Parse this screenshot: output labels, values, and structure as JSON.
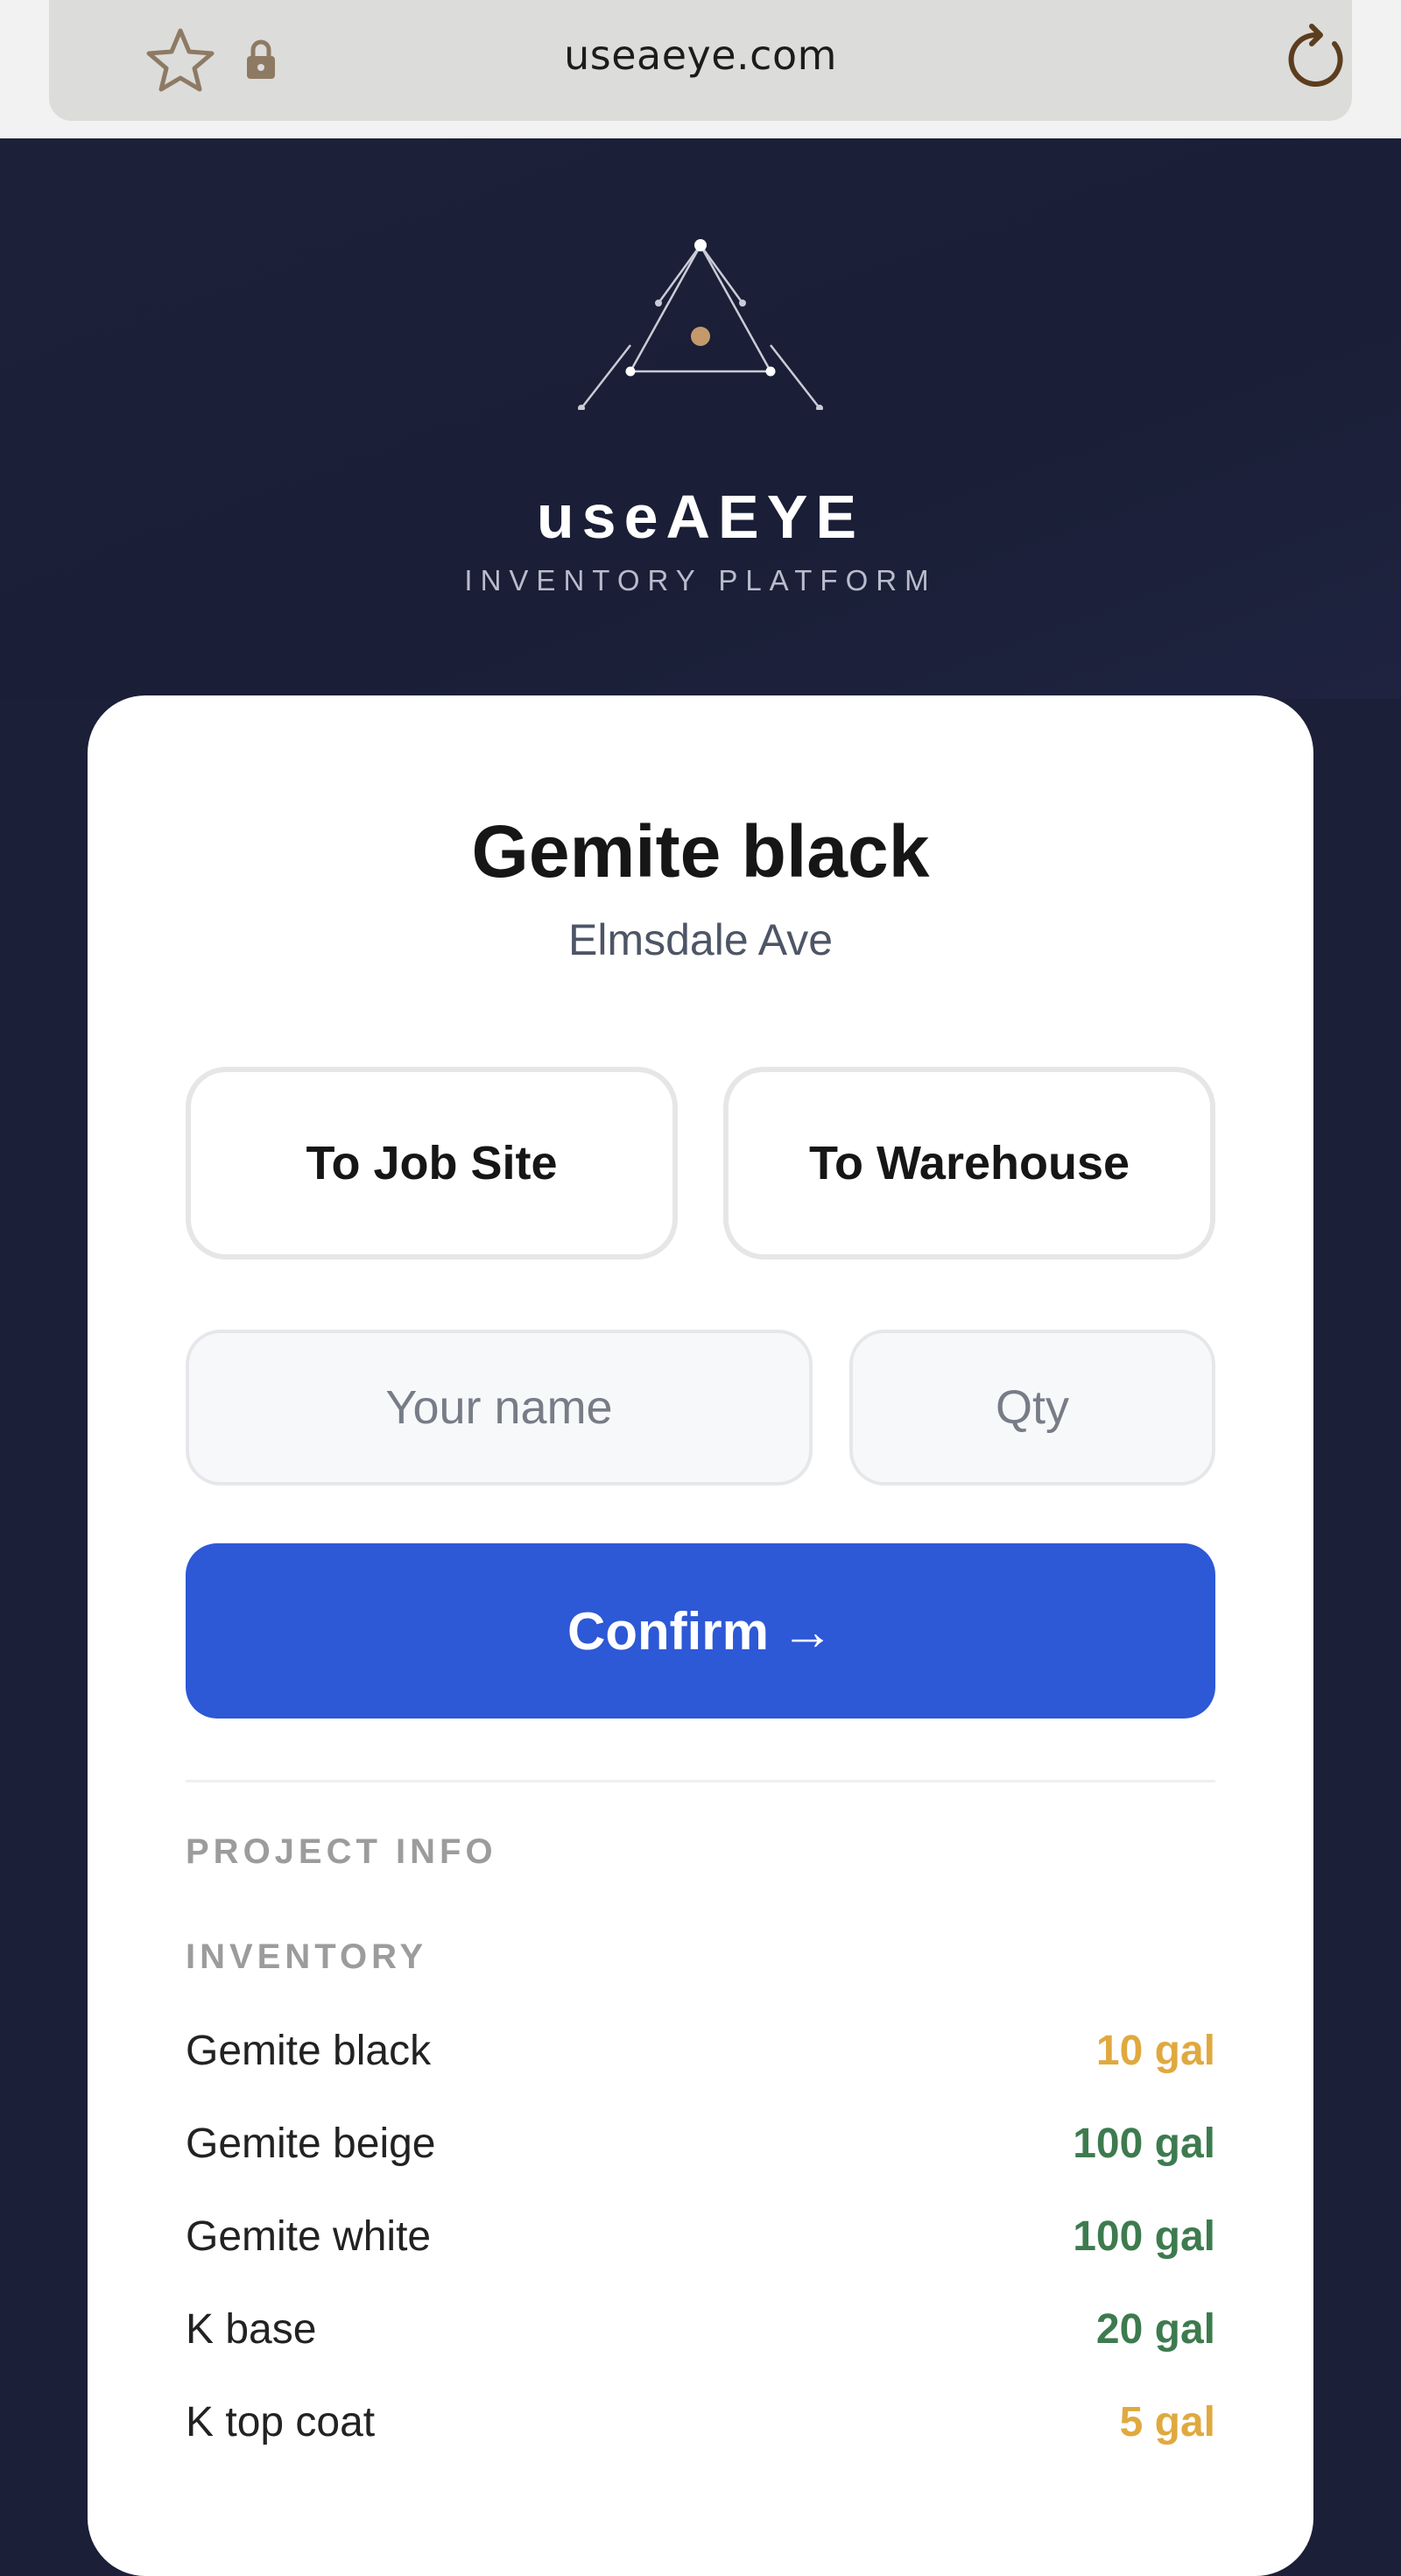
{
  "browser": {
    "url": "useaeye.com"
  },
  "brand": {
    "name": "useAEYE",
    "subtitle": "INVENTORY PLATFORM"
  },
  "product": {
    "title": "Gemite black",
    "project": "Elmsdale Ave"
  },
  "actions": {
    "to_job_site": "To Job Site",
    "to_warehouse": "To Warehouse",
    "name_placeholder": "Your name",
    "qty_placeholder": "Qty",
    "confirm": "Confirm",
    "confirm_arrow": "→"
  },
  "sections": {
    "project_info": "PROJECT INFO",
    "inventory": "INVENTORY"
  },
  "inventory": [
    {
      "name": "Gemite black",
      "qty": "10 gal",
      "color": "#e0a93f"
    },
    {
      "name": "Gemite beige",
      "qty": "100 gal",
      "color": "#3d7b4f"
    },
    {
      "name": "Gemite white",
      "qty": "100 gal",
      "color": "#3d7b4f"
    },
    {
      "name": "K base",
      "qty": "20 gal",
      "color": "#3d7b4f"
    },
    {
      "name": "K top coat",
      "qty": "5 gal",
      "color": "#e0a93f"
    }
  ],
  "colors": {
    "primary": "#2d58d6",
    "background": "#1b1f38",
    "logo_accent": "#c49a6c"
  }
}
